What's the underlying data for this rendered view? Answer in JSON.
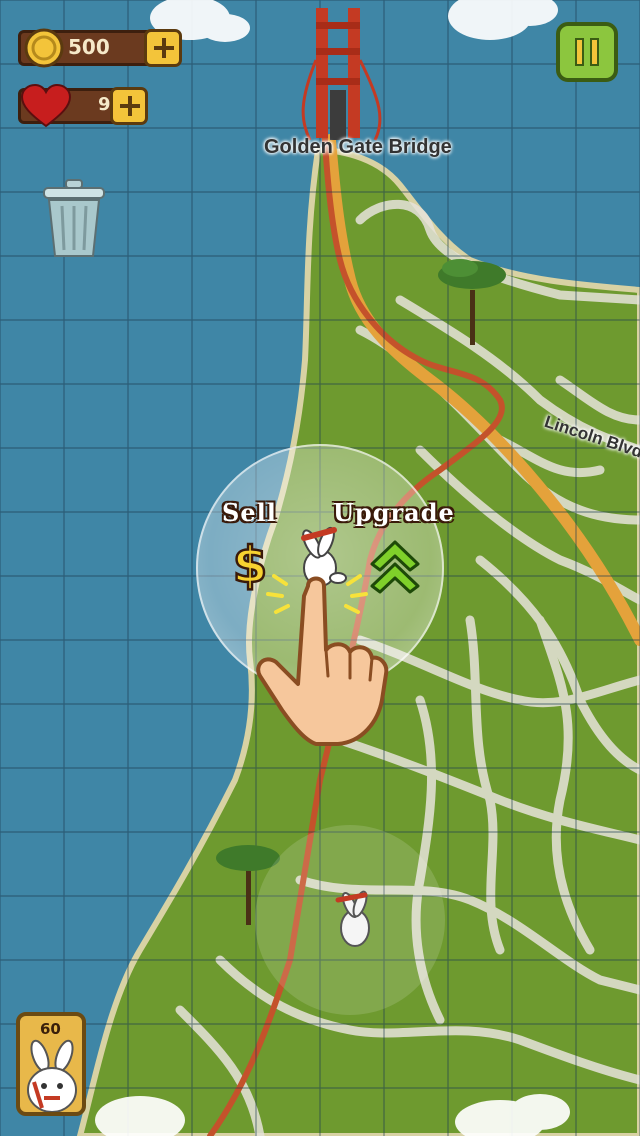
{
  "hud": {
    "coins": "500",
    "lives": "9",
    "icons": {
      "coin": "coin-icon",
      "heart": "heart-icon",
      "plus": "plus-icon",
      "pause": "pause-icon",
      "trash": "trash-can-icon"
    }
  },
  "map": {
    "labels": {
      "bridge": "Golden Gate Bridge",
      "street": "Lincoln Blvd"
    }
  },
  "tower_menu": {
    "sell_label": "Sell",
    "upgrade_label": "Upgrade",
    "sell_icon": "dollar-icon",
    "upgrade_icon": "double-chevron-up-icon"
  },
  "unit_card": {
    "cost": "60",
    "icon": "rabbit-icon"
  },
  "colors": {
    "water": "#3f86a6",
    "land": "#6e9a2f",
    "road": "#e6e3da",
    "highway": "#e4a23b",
    "path": "#c4522b",
    "grid": "#1d3d52",
    "wood": "#6b3a1f",
    "gold": "#f3c43a",
    "pause": "#8cc63e"
  }
}
